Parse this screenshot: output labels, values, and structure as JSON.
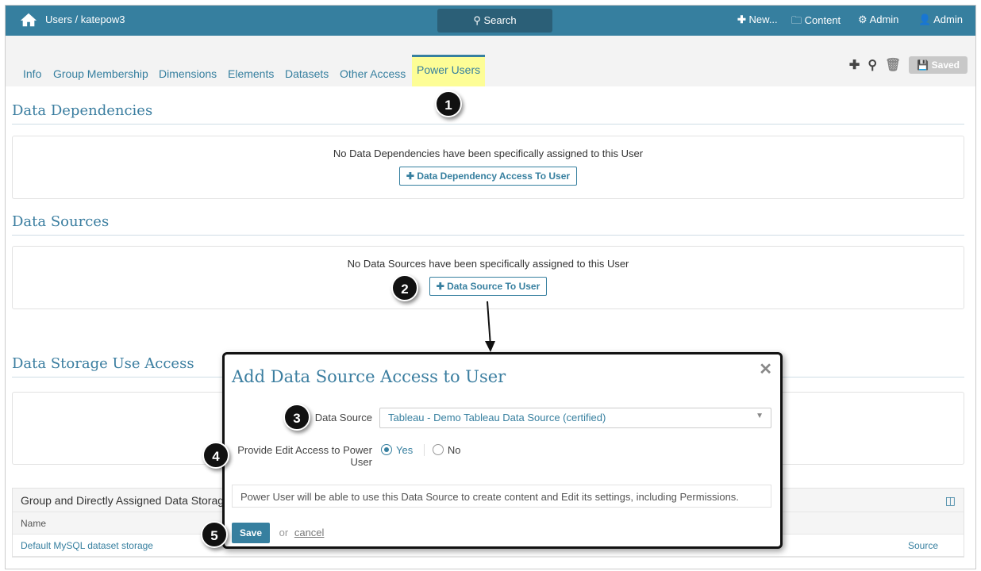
{
  "topbar": {
    "breadcrumb": "Users / katepow3",
    "search": "Search",
    "new": "New...",
    "content": "Content",
    "admin": "Admin",
    "user": "Admin"
  },
  "tabs": [
    "Info",
    "Group Membership",
    "Dimensions",
    "Elements",
    "Datasets",
    "Other Access",
    "Power Users"
  ],
  "toolbar": {
    "saved": "Saved"
  },
  "sections": {
    "deps": {
      "title": "Data Dependencies",
      "empty": "No Data Dependencies have been specifically assigned to this User",
      "button": "Data Dependency Access To User"
    },
    "sources": {
      "title": "Data Sources",
      "empty": "No Data Sources have been specifically assigned to this User",
      "button": "Data Source To User"
    },
    "storage": {
      "title": "Data Storage Use Access"
    }
  },
  "table": {
    "caption": "Group and Directly Assigned Data Storage",
    "header": "Name",
    "row_name": "Default MySQL dataset storage",
    "row_source": "Source"
  },
  "modal": {
    "title": "Add Data Source Access to User",
    "ds_label": "Data Source",
    "ds_value": "Tableau - Demo Tableau Data Source (certified)",
    "edit_label": "Provide Edit Access to Power User",
    "yes": "Yes",
    "no": "No",
    "selected": "Yes",
    "info": "Power User will be able to use this Data Source to create content and Edit its settings, including Permissions.",
    "save": "Save",
    "or": "or",
    "cancel": "cancel"
  },
  "callouts": [
    "1",
    "2",
    "3",
    "4",
    "5"
  ]
}
